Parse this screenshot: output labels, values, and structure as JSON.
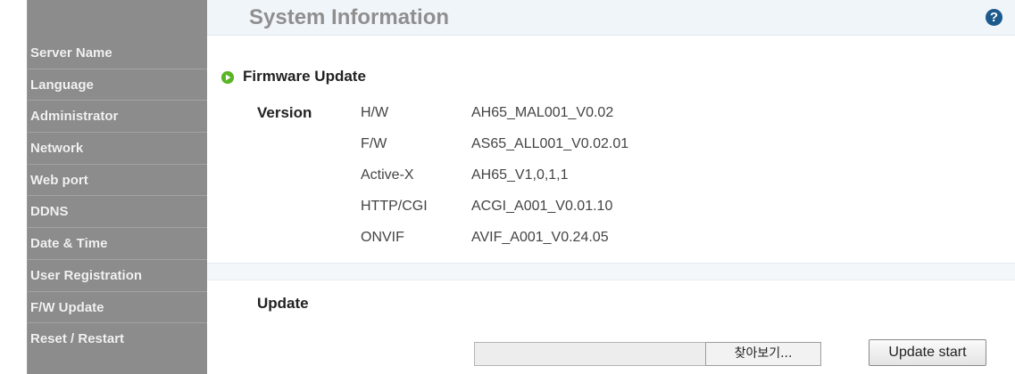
{
  "sidebar": {
    "items": [
      {
        "label": "Server Name"
      },
      {
        "label": "Language"
      },
      {
        "label": "Administrator"
      },
      {
        "label": "Network"
      },
      {
        "label": "Web port"
      },
      {
        "label": "DDNS"
      },
      {
        "label": "Date & Time"
      },
      {
        "label": "User Registration"
      },
      {
        "label": "F/W Update"
      },
      {
        "label": "Reset / Restart"
      }
    ]
  },
  "header": {
    "title": "System Information",
    "help_icon": "question-circle-icon",
    "help_glyph": "?"
  },
  "firmware": {
    "section_icon": "green-play-circle-icon",
    "section_title": "Firmware Update",
    "version_label": "Version",
    "rows": [
      {
        "key": "H/W",
        "value": "AH65_MAL001_V0.02"
      },
      {
        "key": "F/W",
        "value": "AS65_ALL001_V0.02.01"
      },
      {
        "key": "Active-X",
        "value": "AH65_V1,0,1,1"
      },
      {
        "key": "HTTP/CGI",
        "value": "ACGI_A001_V0.01.10"
      },
      {
        "key": "ONVIF",
        "value": "AVIF_A001_V0.24.05"
      }
    ]
  },
  "update": {
    "label": "Update",
    "file_value": "",
    "browse_label": "찾아보기...",
    "start_label": "Update start"
  },
  "colors": {
    "sidebar_bg": "#8c8c8c",
    "title_bar_bg": "#f0f5fa",
    "accent_green": "#5ab526",
    "help_blue": "#1d5a8c"
  }
}
